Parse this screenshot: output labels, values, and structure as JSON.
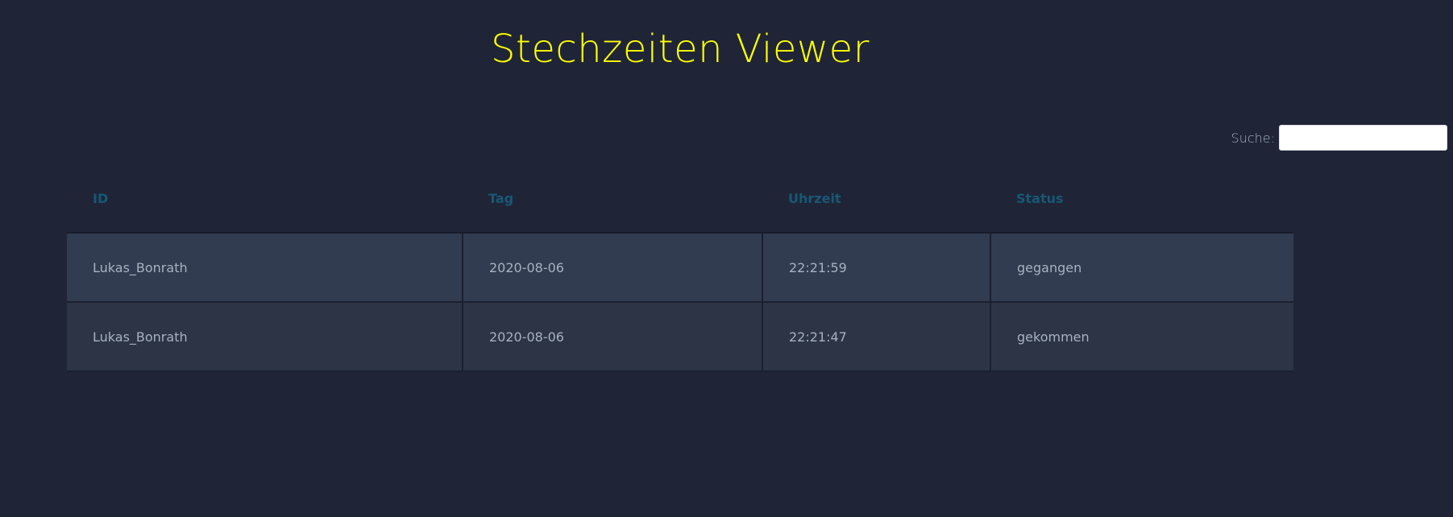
{
  "app": {
    "title": "Stechzeiten Viewer"
  },
  "search": {
    "label": "Suche:",
    "value": "",
    "placeholder": ""
  },
  "table": {
    "columns": [
      "ID",
      "Tag",
      "Uhrzeit",
      "Status"
    ],
    "rows": [
      [
        "Lukas_Bonrath",
        "2020-08-06",
        "22:21:59",
        "gegangen"
      ],
      [
        "Lukas_Bonrath",
        "2020-08-06",
        "22:21:47",
        "gekommen"
      ]
    ]
  },
  "colors": {
    "background": "#1f2537",
    "title": "#ffff00",
    "header_text": "#185875",
    "cell_text": "#a7b1c2",
    "row_odd": "#323c50",
    "row_even": "#2c3446"
  }
}
